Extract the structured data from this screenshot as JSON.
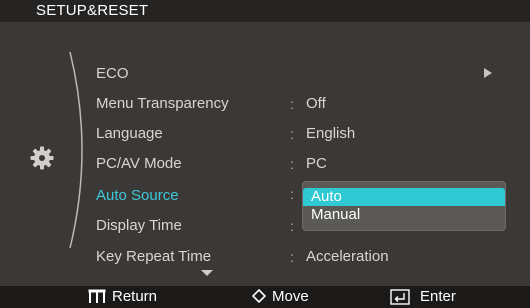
{
  "header": {
    "title": "SETUP&RESET"
  },
  "menu": {
    "items": [
      {
        "label": "ECO",
        "value": "",
        "has_submenu": true
      },
      {
        "label": "Menu Transparency",
        "value": "Off"
      },
      {
        "label": "Language",
        "value": "English"
      },
      {
        "label": "PC/AV Mode",
        "value": "PC"
      },
      {
        "label": "Auto Source",
        "value": "",
        "active": true
      },
      {
        "label": "Display Time",
        "value": ""
      },
      {
        "label": "Key Repeat Time",
        "value": "Acceleration"
      }
    ],
    "separator": ":",
    "section_icon": "gear-icon"
  },
  "dropdown": {
    "options": [
      "Auto",
      "Manual"
    ],
    "selected": "Auto"
  },
  "footer": {
    "return_label": "Return",
    "move_label": "Move",
    "enter_label": "Enter"
  },
  "colors": {
    "background": "#3b3937",
    "header": "#262422",
    "footer": "#1b1a19",
    "accent": "#3ec8d8",
    "highlight": "#2fc9d3"
  }
}
